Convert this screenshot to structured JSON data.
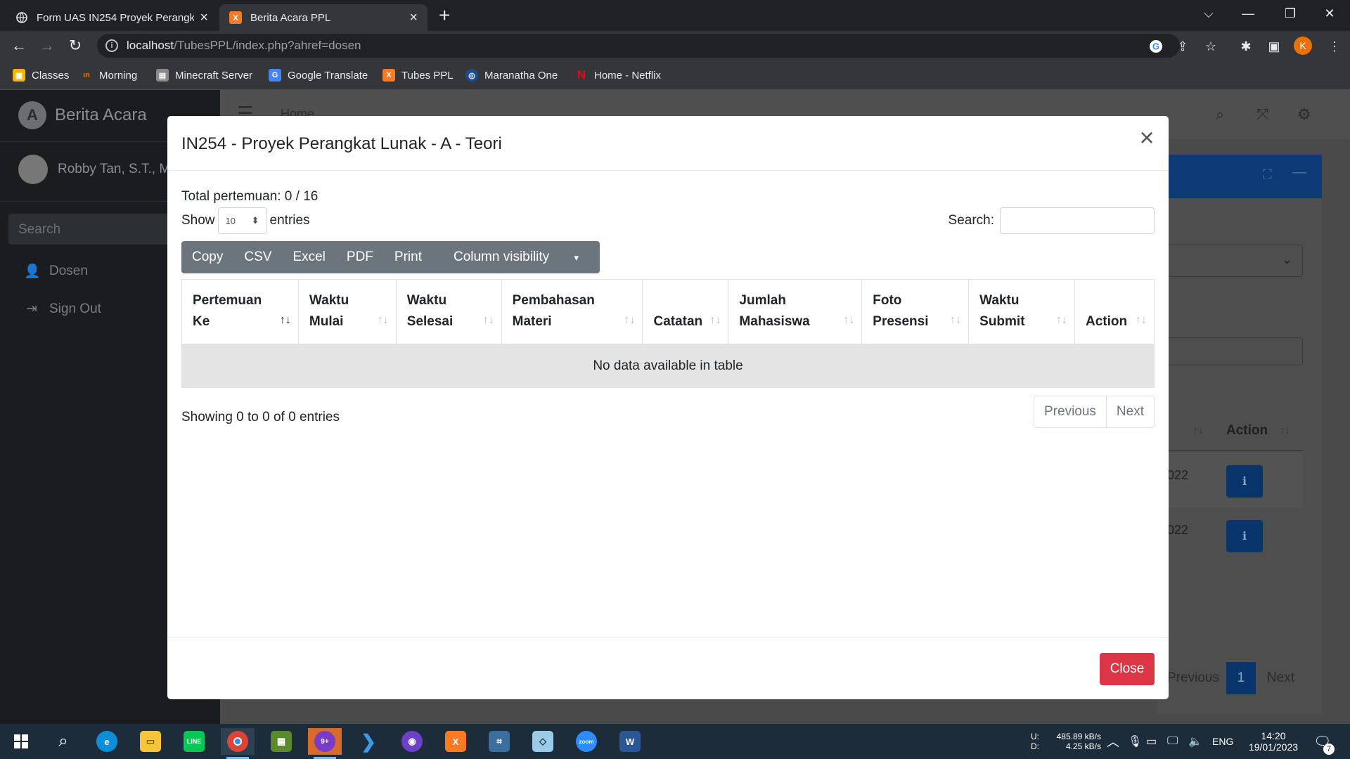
{
  "browser": {
    "tabs": [
      {
        "title": "Form UAS IN254 Proyek Perangk",
        "active": false
      },
      {
        "title": "Berita Acara PPL",
        "active": true
      }
    ],
    "url_host": "localhost",
    "url_path": "/TubesPPL/index.php?ahref=dosen",
    "profile_initial": "K",
    "bookmarks": [
      {
        "label": "Classes",
        "color": "#f4b400"
      },
      {
        "label": "Morning",
        "color": "#e37400"
      },
      {
        "label": "Minecraft Server",
        "color": "#8a8a8a"
      },
      {
        "label": "Google Translate",
        "color": "#4285f4"
      },
      {
        "label": "Tubes PPL",
        "color": "#fb7a24"
      },
      {
        "label": "Maranatha One",
        "color": "#1a4d8f"
      },
      {
        "label": "Home - Netflix",
        "color": "#e50914"
      }
    ]
  },
  "app": {
    "brand": "Berita Acara",
    "user_name": "Robby Tan, S.T., M.K",
    "search_placeholder": "Search",
    "nav": [
      {
        "label": "Dosen",
        "icon": "user-icon"
      },
      {
        "label": "Sign Out",
        "icon": "sign-out-icon"
      }
    ],
    "topnav_home": "Home",
    "bg_table": {
      "header": "Action",
      "rows": [
        {
          "date_fragment": "022"
        },
        {
          "date_fragment": "022"
        }
      ],
      "pager": {
        "previous": "Previous",
        "page": "1",
        "next": "Next"
      }
    }
  },
  "modal": {
    "title": "IN254 - Proyek Perangkat Lunak - A - Teori",
    "total_label": "Total pertemuan: 0 / 16",
    "show_label": "Show",
    "entries_value": "10",
    "entries_label": "entries",
    "search_label": "Search:",
    "buttons": [
      "Copy",
      "CSV",
      "Excel",
      "PDF",
      "Print",
      "Column visibility"
    ],
    "columns": [
      {
        "line1": "Pertemuan",
        "line2": "Ke",
        "sorted": true
      },
      {
        "line1": "Waktu",
        "line2": "Mulai",
        "sorted": false
      },
      {
        "line1": "Waktu",
        "line2": "Selesai",
        "sorted": false
      },
      {
        "line1": "Pembahasan",
        "line2": "Materi",
        "sorted": false
      },
      {
        "line1": "",
        "line2": "Catatan",
        "sorted": false
      },
      {
        "line1": "Jumlah",
        "line2": "Mahasiswa",
        "sorted": false
      },
      {
        "line1": "Foto",
        "line2": "Presensi",
        "sorted": false
      },
      {
        "line1": "Waktu",
        "line2": "Submit",
        "sorted": false
      },
      {
        "line1": "",
        "line2": "Action",
        "sorted": false
      }
    ],
    "empty_message": "No data available in table",
    "showing": "Showing 0 to 0 of 0 entries",
    "pager": {
      "previous": "Previous",
      "next": "Next"
    },
    "close_label": "Close"
  },
  "taskbar": {
    "net_up_label": "U:",
    "net_up": "485.89 kB/s",
    "net_down_label": "D:",
    "net_down": "4.25 kB/s",
    "lang": "ENG",
    "time": "14:20",
    "date": "19/01/2023",
    "notifications": "7"
  }
}
